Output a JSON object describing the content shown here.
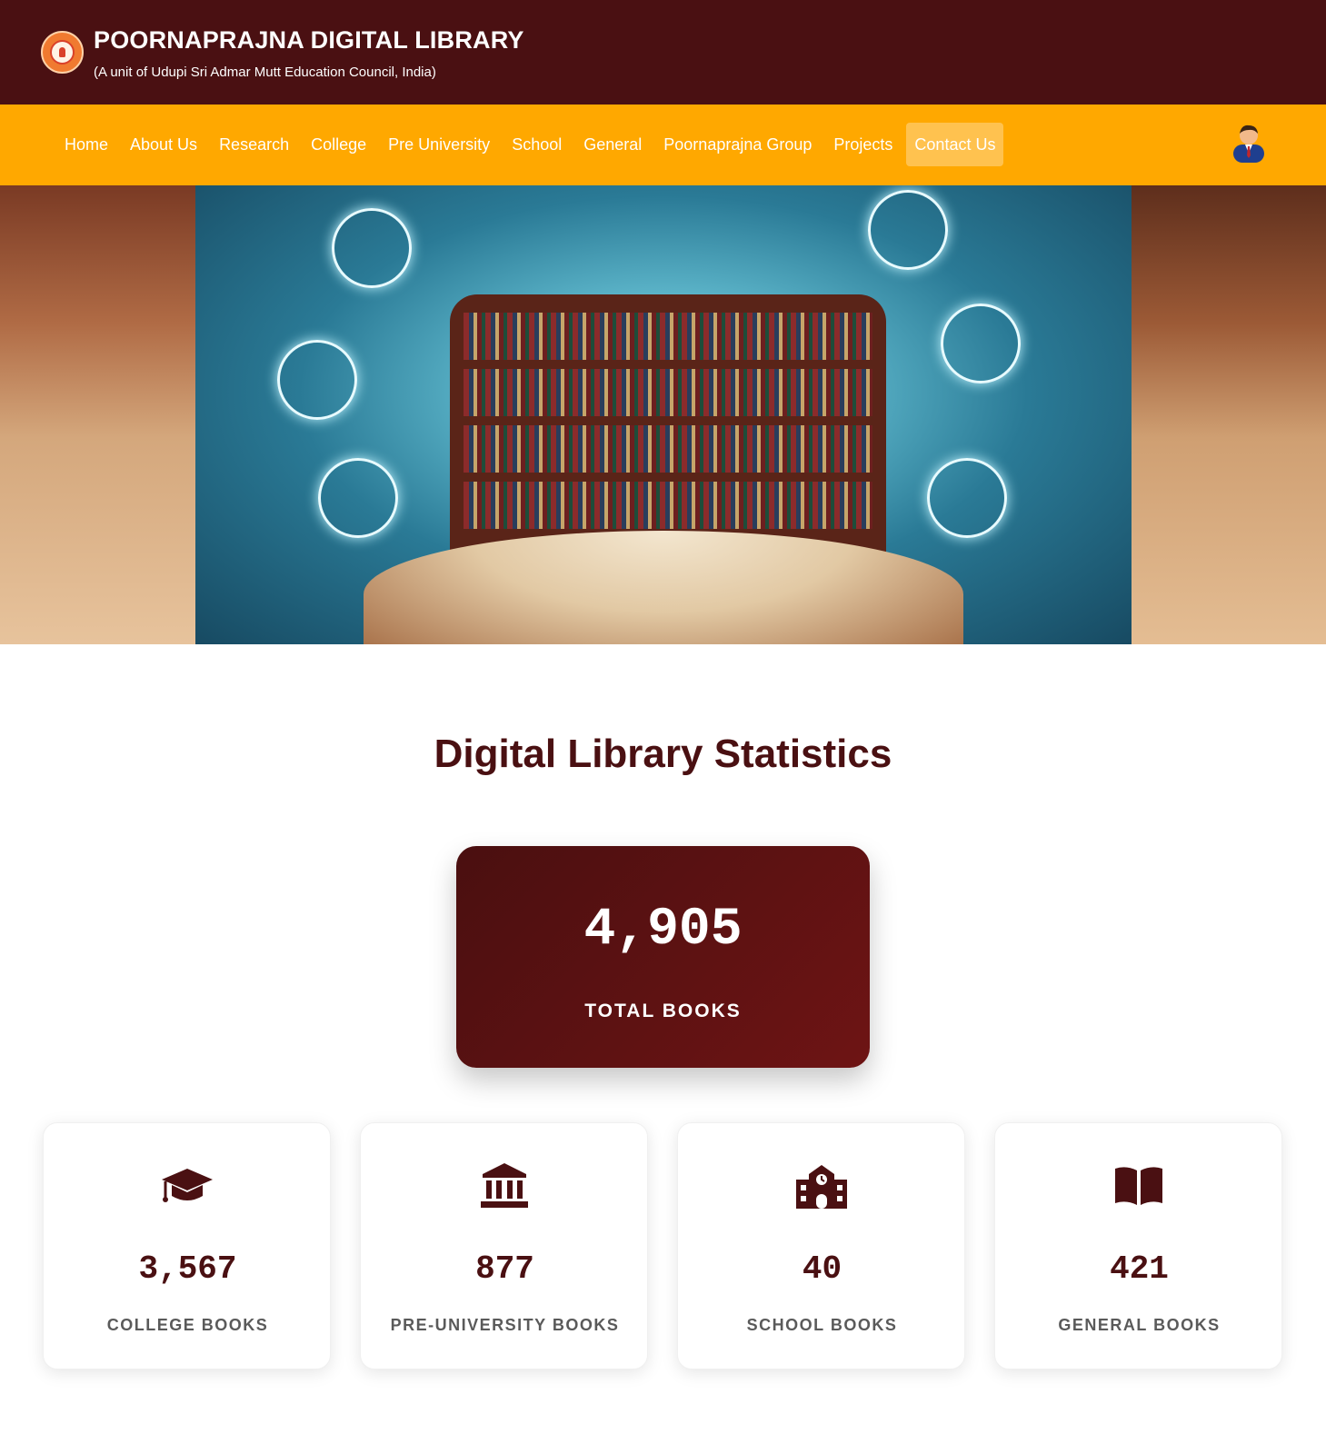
{
  "header": {
    "title": "POORNAPRAJNA DIGITAL LIBRARY",
    "subtitle": "(A unit of Udupi Sri Admar Mutt Education Council, India)",
    "logo_icon": "institution-seal-icon"
  },
  "nav": {
    "items": [
      {
        "label": "Home"
      },
      {
        "label": "About Us"
      },
      {
        "label": "Research"
      },
      {
        "label": "College"
      },
      {
        "label": "Pre University"
      },
      {
        "label": "School"
      },
      {
        "label": "General"
      },
      {
        "label": "Poornaprajna Group"
      },
      {
        "label": "Projects"
      },
      {
        "label": "Contact Us"
      }
    ],
    "active": "Contact Us",
    "user_icon": "user-avatar-icon"
  },
  "hero": {
    "image": "digital-library-banner"
  },
  "stats": {
    "title": "Digital Library Statistics",
    "total": {
      "value": "4,905",
      "label": "TOTAL BOOKS"
    },
    "categories": [
      {
        "icon": "graduation-cap-icon",
        "value": "3,567",
        "label": "COLLEGE BOOKS"
      },
      {
        "icon": "university-building-icon",
        "value": "877",
        "label": "PRE-UNIVERSITY BOOKS"
      },
      {
        "icon": "school-building-icon",
        "value": "40",
        "label": "SCHOOL BOOKS"
      },
      {
        "icon": "open-book-icon",
        "value": "421",
        "label": "GENERAL BOOKS"
      }
    ]
  },
  "colors": {
    "header_bg": "#4a1012",
    "nav_bg": "#ffa800",
    "accent": "#4a1012",
    "card_gradient_start": "#4a0f10",
    "card_gradient_end": "#6e1414"
  }
}
